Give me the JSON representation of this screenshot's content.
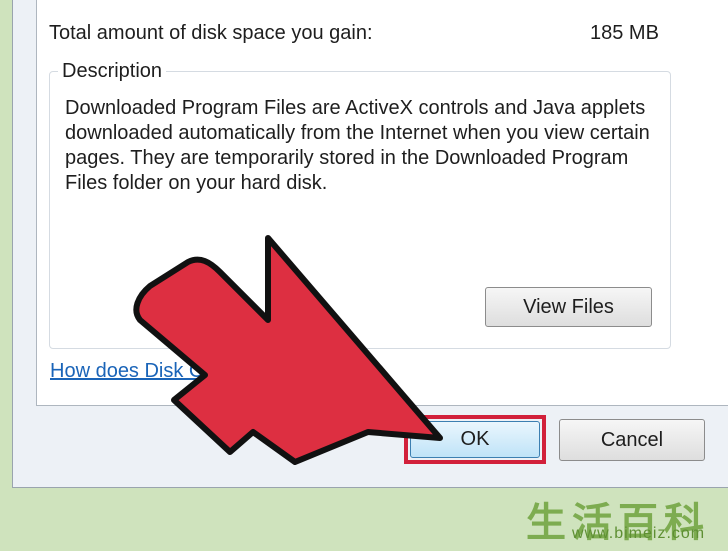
{
  "disk_space": {
    "label": "Total amount of disk space you gain:",
    "value": "185 MB"
  },
  "description": {
    "legend": "Description",
    "text": "Downloaded Program Files are ActiveX controls and Java applets downloaded automatically from the Internet when you view certain pages. They are temporarily stored in the Downloaded Program Files folder on your hard disk."
  },
  "buttons": {
    "view_files": "View Files",
    "ok": "OK",
    "cancel": "Cancel"
  },
  "help_link": "How does Disk Clea",
  "annotation": {
    "arrow_color": "#dd2f41",
    "highlight_color": "#d2203a"
  },
  "watermark": {
    "chars": "生活百科",
    "url": "www.bimeiz.com"
  }
}
